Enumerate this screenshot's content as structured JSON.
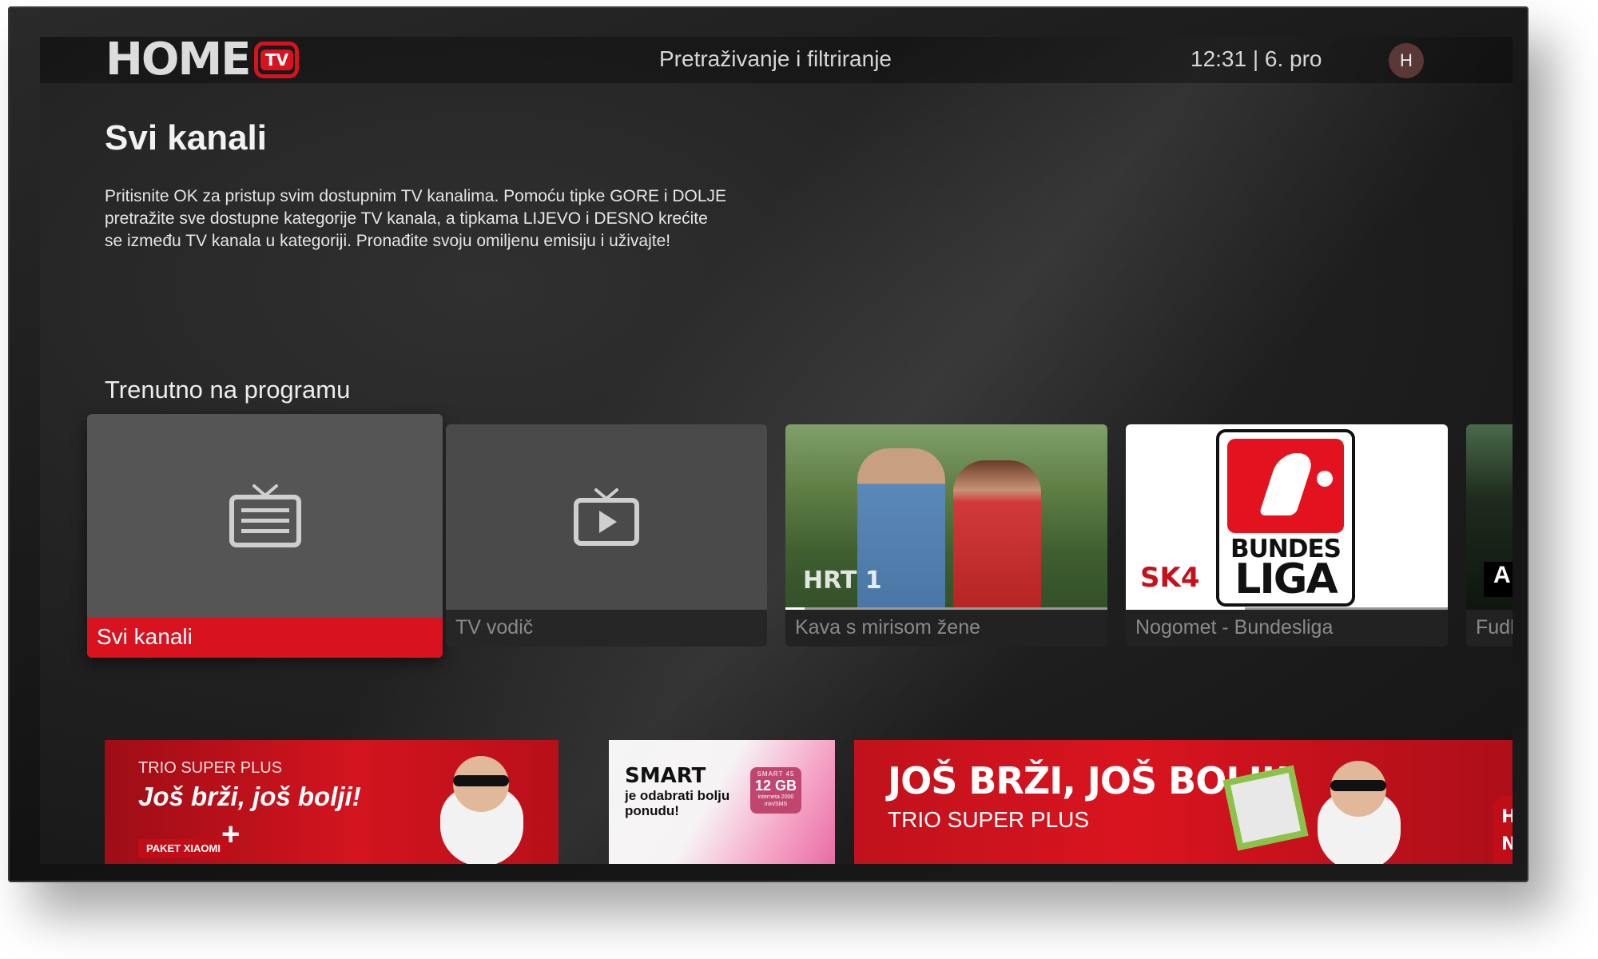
{
  "header": {
    "logo_text": "HOME",
    "logo_badge": "TV",
    "search_label": "Pretraživanje i filtriranje",
    "clock": "12:31 | 6. pro",
    "avatar_initial": "H"
  },
  "page": {
    "title": "Svi kanali",
    "description": "Pritisnite OK za pristup svim dostupnim TV kanalima. Pomoću tipke GORE i DOLJE pretražite sve dostupne kategorije TV kanala, a tipkama LIJEVO i DESNO krećite se između TV kanala u kategoriji. Pronađite svoju omiljenu emisiju i uživajte!"
  },
  "now_playing": {
    "section_title": "Trenutno na programu",
    "cards": [
      {
        "label": "Svi kanali",
        "icon": "tv-list-icon",
        "selected": true
      },
      {
        "label": "TV vodič",
        "icon": "tv-play-icon"
      },
      {
        "label": "Kava s mirisom žene",
        "channel_logo": "HRT 1",
        "progress": 0.06
      },
      {
        "label": "Nogomet - Bundesliga",
        "channel_logo": "SK4",
        "logo_line1": "BUNDES",
        "logo_line2": "LIGA",
        "progress": 0.37
      },
      {
        "label": "Fudb",
        "channel_logo": "A"
      }
    ]
  },
  "banners": {
    "trio": {
      "subtitle": "TRIO SUPER PLUS",
      "title": "Još brži, još bolji!",
      "plus": "+",
      "tag": "PAKET XIAOMI"
    },
    "smart": {
      "title": "SMART",
      "subtitle": "je odabrati bolju ponudu!",
      "badge_top": "SMART 45",
      "badge_main": "12 GB",
      "badge_bottom": "interneta 2000 min/SMS"
    },
    "big": {
      "title": "JOŠ BRŽI, JOŠ BOLJI!",
      "subtitle": "TRIO SUPER PLUS",
      "tag_line1": "HOM",
      "tag_line2": "NAJB"
    }
  },
  "colors": {
    "accent": "#d8121f",
    "background": "#1f1f1f",
    "card": "#333333"
  }
}
